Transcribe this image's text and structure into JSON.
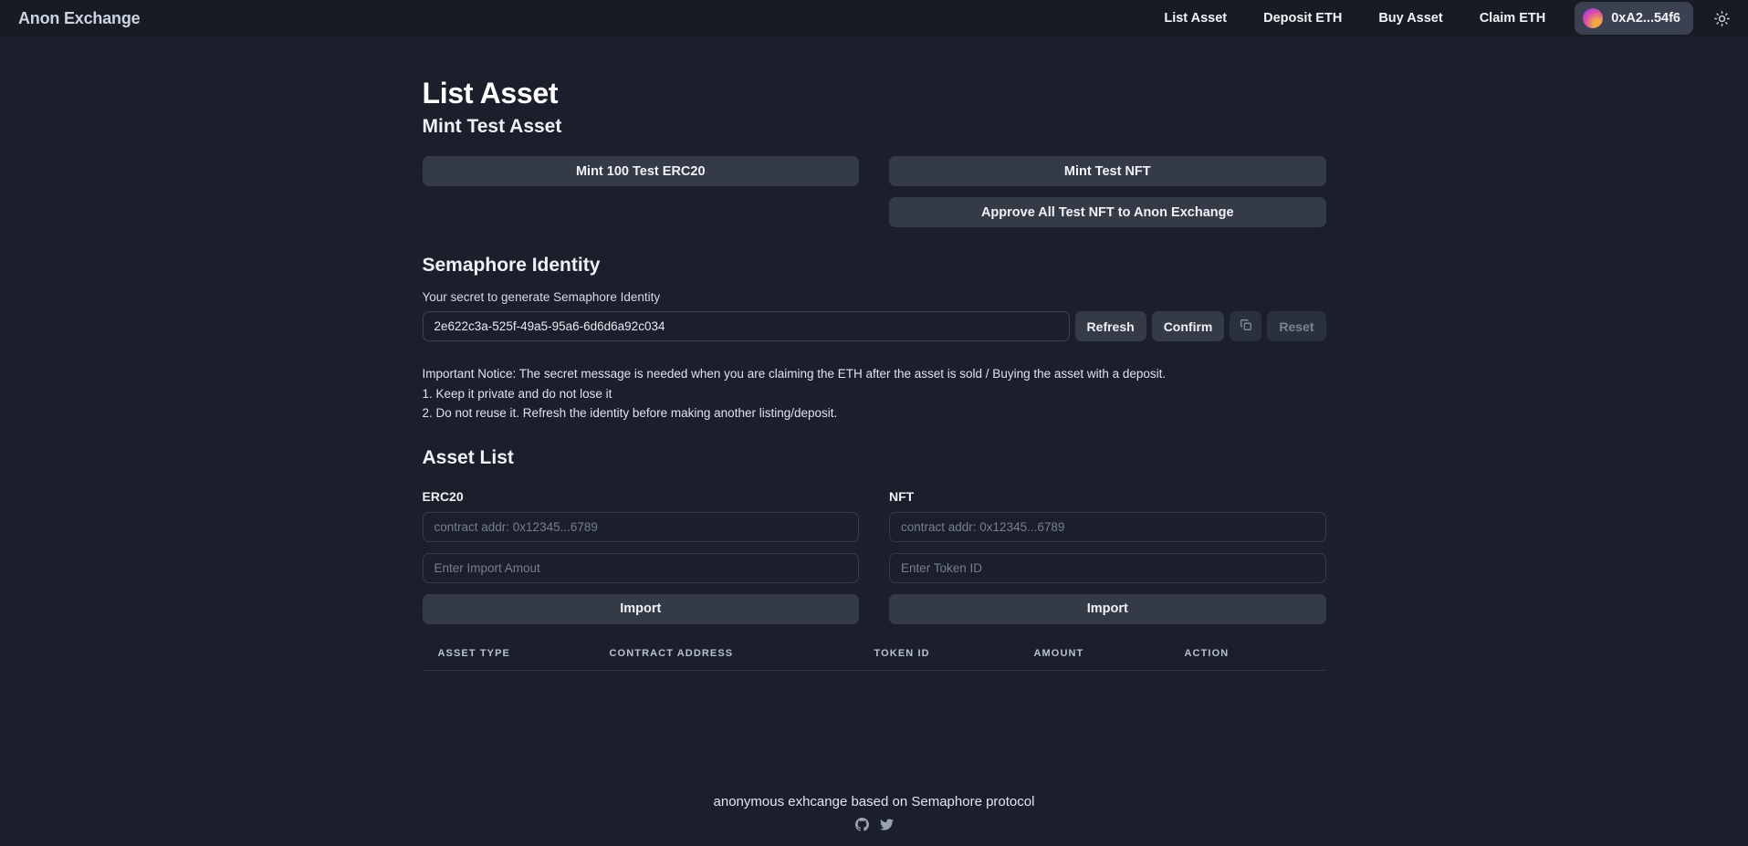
{
  "navbar": {
    "brand": "Anon Exchange",
    "links": [
      {
        "label": "List Asset"
      },
      {
        "label": "Deposit ETH"
      },
      {
        "label": "Buy Asset"
      },
      {
        "label": "Claim ETH"
      }
    ],
    "wallet": {
      "address": "0xA2...54f6",
      "avatar_icon": "gradient-avatar"
    },
    "theme_toggle_icon": "sun-icon",
    "colors": {
      "bar_bg": "#171b24",
      "wallet_bg": "#3b4150"
    }
  },
  "main": {
    "page_title": "List Asset",
    "mint": {
      "section_title": "Mint Test Asset",
      "mint_erc20_label": "Mint 100 Test ERC20",
      "mint_nft_label": "Mint Test NFT",
      "approve_nft_label": "Approve All Test NFT to Anon Exchange"
    },
    "semaphore": {
      "section_title": "Semaphore Identity",
      "field_label": "Your secret to generate Semaphore Identity",
      "secret_value": "2e622c3a-525f-49a5-95a6-6d6d6a92c034",
      "refresh_label": "Refresh",
      "confirm_label": "Confirm",
      "copy_icon": "copy-icon",
      "reset_label": "Reset",
      "reset_disabled": true,
      "notice": [
        "Important Notice: The secret message is needed when you are claiming the ETH after the asset is sold / Buying the asset with a deposit.",
        "1. Keep it private and do not lose it",
        "2. Do not reuse it. Refresh the identity before making another listing/deposit."
      ]
    },
    "asset_list": {
      "section_title": "Asset List",
      "erc20": {
        "heading": "ERC20",
        "contract_placeholder": "contract addr: 0x12345...6789",
        "contract_value": "",
        "amount_placeholder": "Enter Import Amout",
        "amount_value": "",
        "import_label": "Import"
      },
      "nft": {
        "heading": "NFT",
        "contract_placeholder": "contract addr: 0x12345...6789",
        "contract_value": "",
        "token_placeholder": "Enter Token ID",
        "token_value": "",
        "import_label": "Import"
      },
      "table": {
        "columns": [
          "ASSET TYPE",
          "CONTRACT ADDRESS",
          "TOKEN ID",
          "AMOUNT",
          "ACTION"
        ],
        "rows": []
      }
    }
  },
  "footer": {
    "text": "anonymous exhcange based on Semaphore protocol",
    "icons": [
      {
        "name": "github-icon"
      },
      {
        "name": "twitter-icon"
      }
    ]
  },
  "colors": {
    "page_bg": "#1a1f2b",
    "button_bg": "#343a46",
    "border": "#343b48",
    "text_primary": "#eef1f6",
    "text_muted": "#767e90"
  }
}
